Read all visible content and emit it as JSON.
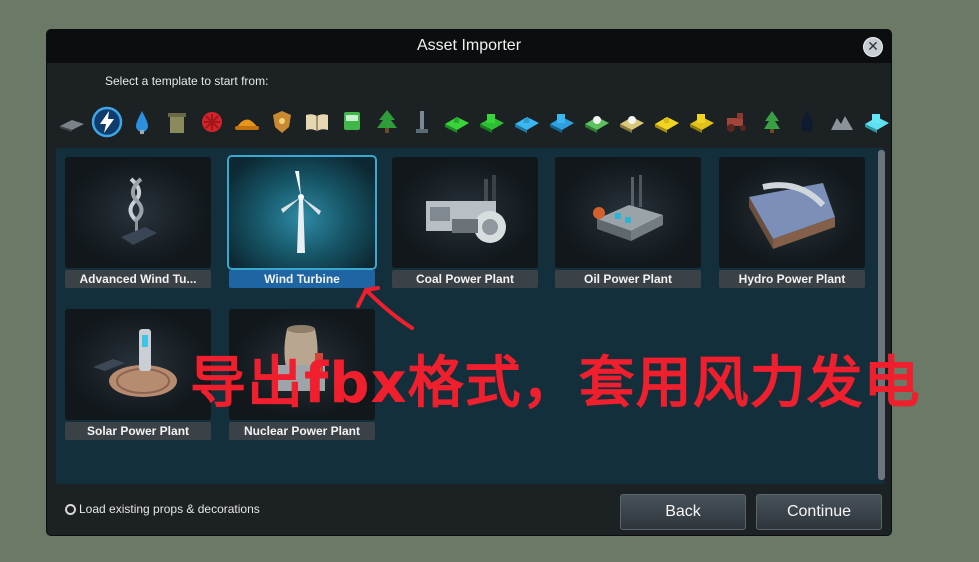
{
  "window": {
    "title": "Asset Importer",
    "close_icon": "close-icon"
  },
  "subtitle": "Select a template to start from:",
  "categories": [
    "solar-panel-icon",
    "electricity-icon",
    "water-drop-icon",
    "garbage-bin-icon",
    "healthcare-icon",
    "fire-helmet-icon",
    "police-badge-icon",
    "education-book-icon",
    "bus-icon",
    "park-tree-icon",
    "monument-icon",
    "residential-low-icon",
    "residential-high-icon",
    "commercial-low-icon",
    "commercial-high-icon",
    "leisure-icon",
    "tourism-icon",
    "farming-icon",
    "industry-icon",
    "tractor-icon",
    "forestry-icon",
    "oil-icon",
    "ore-icon",
    "office-icon"
  ],
  "templates": [
    {
      "label": "Advanced Wind Tu...",
      "icon": "advanced-wind-turbine-icon",
      "selected": false
    },
    {
      "label": "Wind Turbine",
      "icon": "wind-turbine-icon",
      "selected": true
    },
    {
      "label": "Coal Power Plant",
      "icon": "coal-power-plant-icon",
      "selected": false
    },
    {
      "label": "Oil Power Plant",
      "icon": "oil-power-plant-icon",
      "selected": false
    },
    {
      "label": "Hydro Power Plant",
      "icon": "hydro-power-plant-icon",
      "selected": false
    },
    {
      "label": "Solar Power Plant",
      "icon": "solar-power-plant-icon",
      "selected": false
    },
    {
      "label": "Nuclear Power Plant",
      "icon": "nuclear-power-plant-icon",
      "selected": false
    }
  ],
  "footer": {
    "load_label": "Load existing props & decorations",
    "back_label": "Back",
    "continue_label": "Continue"
  },
  "annotation": {
    "text": "导出fbx格式，套用风力发电",
    "color": "#ef1f2e"
  }
}
